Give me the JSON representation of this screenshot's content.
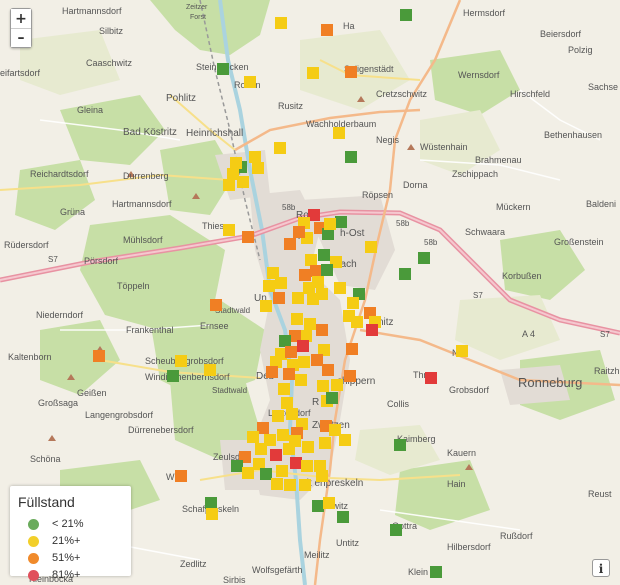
{
  "controls": {
    "zoom_in": "+",
    "zoom_out": "–",
    "info": "i"
  },
  "legend": {
    "title": "Füllstand",
    "items": [
      {
        "label": "< 21%",
        "color": "#6aab5c"
      },
      {
        "label": "21%+",
        "color": "#f2cf2a"
      },
      {
        "label": "51%+",
        "color": "#f08a2b"
      },
      {
        "label": "81%+",
        "color": "#e0505c"
      }
    ]
  },
  "marker_colors": {
    "green": "#4a9a3a",
    "yellow": "#f5cc14",
    "orange": "#f07f24",
    "red": "#e23a3a"
  },
  "labels": {
    "hartmannsdorf_n": "Hartmannsdorf",
    "zeitzer": "Zeitzer",
    "forst": "Forst",
    "ha": "Ha",
    "hermsdorf": "Hermsdorf",
    "beiersdorf": "Beiersdorf",
    "silbitz": "Silbitz",
    "polzig": "Polzig",
    "caaschwitz": "Caaschwitz",
    "steinbrucken": "Steinbrücken",
    "seligenstadt": "Seligenstädt",
    "wernsdorf": "Wernsdorf",
    "eifartsdorf": "eifartsdorf",
    "roben": "Roben",
    "sachse": "Sachse",
    "pohlitz": "Pohlitz",
    "rusitz": "Rusitz",
    "cretzschwitz": "Cretzschwitz",
    "hirschfeld": "Hirschfeld",
    "gleina": "Gleina",
    "wachholderbaum": "Wachholderbaum",
    "bad_kostritz": "Bad Köstritz",
    "heinrichshall": "Heinrichshall",
    "negis": "Negis",
    "wustenhain": "Wüstenhain",
    "bethenhausen": "Bethenhausen",
    "reichardtsdorf": "Reichardtsdorf",
    "brahmenau": "Brahmenau",
    "zschippach": "Zschippach",
    "durrenberg": "Durrenberg",
    "ropsen": "Röpsen",
    "dorna": "Dorna",
    "hartmannsdorf_s": "Hartmannsdorf",
    "grana": "Grüna",
    "ro": "Ro",
    "muckern": "Mückern",
    "baldeni": "Baldeni",
    "thieschitz": "Thiesc",
    "tin": "Tin",
    "h_ost": "h-Ost",
    "schwaara": "Schwaara",
    "grossenstein": "Großenstein",
    "rudersdorf": "Rüdersdorf",
    "muhlsdorf": "Mühlsdorf",
    "porsdorf": "Pörsdorf",
    "bach": "bach",
    "korbussen": "Korbußen",
    "toppeln": "Töppeln",
    "un": "Un",
    "niederndorf": "Niederndorf",
    "frankenthal": "Frankenthal",
    "stadtwald1": "Stadtwald",
    "ernsee": "Ernsee",
    "nitz": "nitz",
    "a4": "A 4",
    "ronneburg": "Ronneburg",
    "raitzhain": "Raitzh",
    "kaltenborn": "Kaltenborn",
    "scheubengrobsdorf": "Scheubengrobsdorf",
    "windischenbernsdorf": "Windischenbernsdorf",
    "deb": "Deb",
    "zwotzen_a": "Zwötzen",
    "schippern": "chippern",
    "na": "Na",
    "thrr": "Thr",
    "geissen": "Geißen",
    "stadtwald2": "Stadtwald",
    "rn": "R",
    "collis": "Collis",
    "grobsdorf": "Grobsdorf",
    "grossaga": "Großsaga",
    "langengrobsdorf": "Langengrobsdorf",
    "letzendorf": "Letzendorf",
    "durrenebersdorf": "Dürrenebersdorf",
    "zwotzen": "Zwötzen",
    "kaimberg": "Kaimberg",
    "schona": "Schöna",
    "kauern": "Kauern",
    "zeulsdorf": "Zeulsdorf",
    "wolfsgefarth_w": "W",
    "altenpreskeln": "Alt enpreskeln",
    "hain": "Hain",
    "reust": "Reust",
    "schafpreskeln": "Schafpreskeln",
    "lusswitz": "Loswitz",
    "gottra": "Gottra",
    "russdorf": "Rußdorf",
    "hilbersdorf": "Hilbersdorf",
    "untitz": "Untitz",
    "zedlitz": "Zedlitz",
    "meilitz": "Meilitz",
    "wolfsgefarth": "Wolfsgefärth",
    "sirbis": "Sirbis",
    "kleinbocka": "Kleinbocka",
    "kleinfalk": "Klein",
    "s7_a": "S7",
    "s8b_a": "58b",
    "s8b_b": "58b",
    "s8b_c": "58b",
    "s7_b": "S7",
    "s7_c": "S7"
  }
}
